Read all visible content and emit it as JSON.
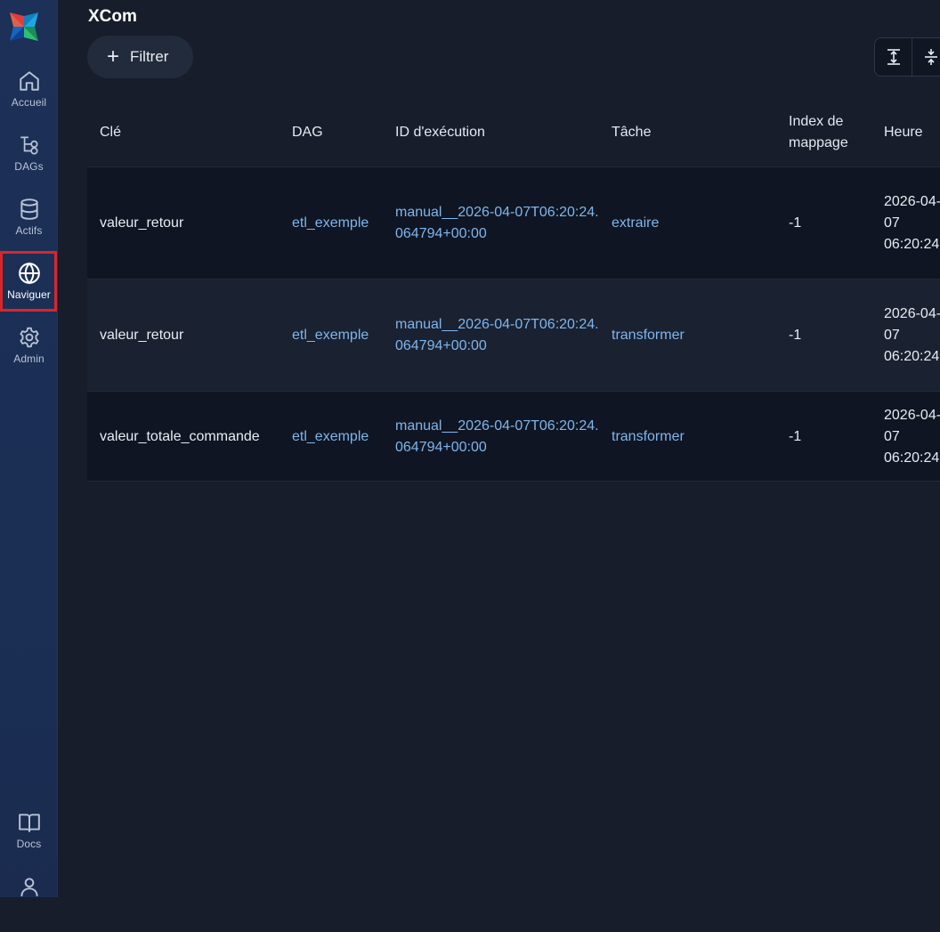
{
  "sidebar": {
    "items": [
      {
        "label": "Accueil",
        "icon": "home-icon"
      },
      {
        "label": "DAGs",
        "icon": "dags-icon"
      },
      {
        "label": "Actifs",
        "icon": "database-icon"
      },
      {
        "label": "Naviguer",
        "icon": "globe-icon",
        "active": true
      },
      {
        "label": "Admin",
        "icon": "gear-icon"
      }
    ],
    "bottom_items": [
      {
        "label": "Docs",
        "icon": "book-icon"
      },
      {
        "label": "",
        "icon": "user-icon"
      }
    ]
  },
  "page": {
    "title": "XCom",
    "filter_label": "Filtrer"
  },
  "table": {
    "headers": {
      "key": "Clé",
      "dag": "DAG",
      "run_id": "ID d'exécution",
      "task": "Tâche",
      "map_index": "Index de mappage",
      "time": "Heure"
    },
    "rows": [
      {
        "key": "valeur_retour",
        "dag": "etl_exemple",
        "run_id": "manual__2026-04-07T06:20:24.064794+00:00",
        "task": "extraire",
        "map_index": "-1",
        "time": "2026-04-07 06:20:24"
      },
      {
        "key": "valeur_retour",
        "dag": "etl_exemple",
        "run_id": "manual__2026-04-07T06:20:24.064794+00:00",
        "task": "transformer",
        "map_index": "-1",
        "time": "2026-04-07 06:20:24"
      },
      {
        "key": "valeur_totale_commande",
        "dag": "etl_exemple",
        "run_id": "manual__2026-04-07T06:20:24.064794+00:00",
        "task": "transformer",
        "map_index": "-1",
        "time": "2026-04-07 06:20:24"
      }
    ]
  },
  "colors": {
    "sidebar_bg": "#1c3058",
    "main_bg": "#171d2b",
    "link": "#7eb6ee",
    "active_outline": "#d8262a"
  }
}
